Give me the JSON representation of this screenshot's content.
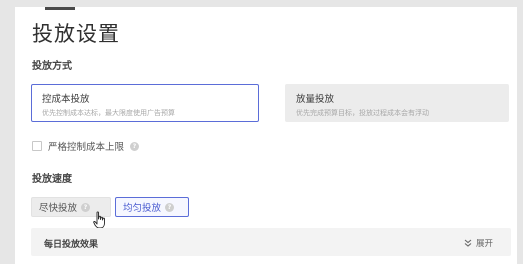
{
  "page": {
    "title": "投放设置"
  },
  "delivery_method": {
    "label": "投放方式",
    "options": [
      {
        "title": "控成本投放",
        "desc": "优先控制成本达标，最大限度使用广告预算",
        "selected": true
      },
      {
        "title": "放量投放",
        "desc": "优先完成预算目标，投放过程成本会有浮动",
        "selected": false
      }
    ]
  },
  "cost_cap": {
    "label": "严格控制成本上限",
    "checked": false,
    "help_icon": "question-circle-icon"
  },
  "delivery_speed": {
    "label": "投放速度",
    "options": [
      {
        "label": "尽快投放",
        "selected": false,
        "help_icon": "question-circle-icon"
      },
      {
        "label": "均匀投放",
        "selected": true,
        "help_icon": "question-circle-icon"
      }
    ]
  },
  "daily_effect": {
    "title": "每日投放效果",
    "expand_label": "展开",
    "expand_icon": "double-chevron-down-icon"
  },
  "colors": {
    "accent": "#5b6dd8",
    "selected_bg": "#f6f7ff",
    "disabled_bg": "#ececec"
  }
}
